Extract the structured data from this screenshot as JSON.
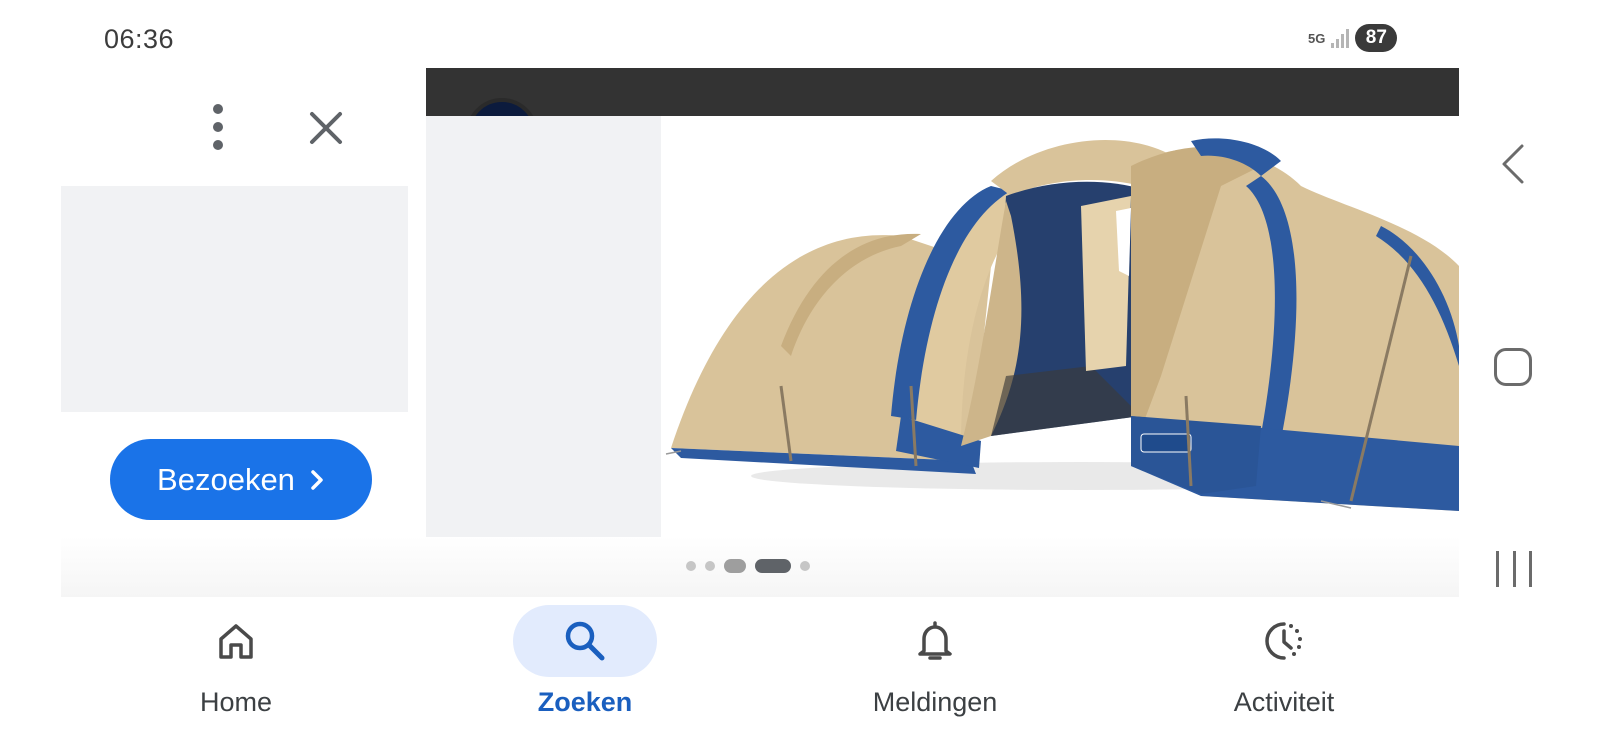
{
  "status_bar": {
    "time": "06:36",
    "network": "5G",
    "battery": "87"
  },
  "actions": {
    "more_icon": "more-vert-icon",
    "close_icon": "close-icon",
    "visit_label": "Bezoeken",
    "visit_icon": "chevron-right-icon"
  },
  "carousel": {
    "total_dots": 5,
    "active_index": 3,
    "slide_subject": "tent-image"
  },
  "bottom_nav": {
    "items": [
      {
        "label": "Home",
        "icon": "home-icon",
        "active": false
      },
      {
        "label": "Zoeken",
        "icon": "search-icon",
        "active": true
      },
      {
        "label": "Meldingen",
        "icon": "bell-icon",
        "active": false
      },
      {
        "label": "Activiteit",
        "icon": "activity-icon",
        "active": false
      }
    ]
  },
  "colors": {
    "accent": "#1a73e8",
    "active_nav_bg": "#e2ebfd",
    "active_nav_text": "#1a5fbf",
    "tent_blue": "#2d5aa0",
    "tent_beige": "#d9c39a"
  }
}
